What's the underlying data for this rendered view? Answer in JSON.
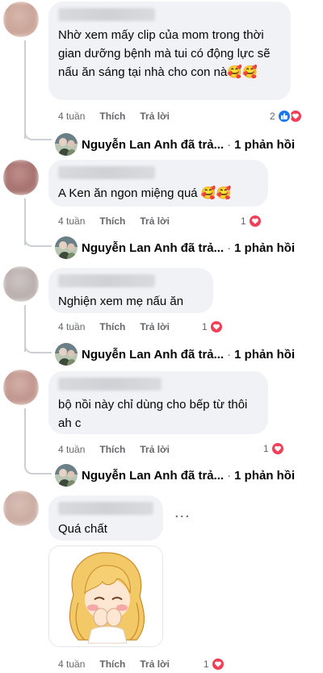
{
  "colors": {
    "bubble_bg": "#f0f2f5",
    "meta_text": "#65676b",
    "like_blue": "#1877f2",
    "heart_red": "#f33e58",
    "thread_line": "#ccd0d5"
  },
  "reply_user": "Nguyễn Lan Anh đã trả...",
  "reply_count": "1 phản hồi",
  "separator": "·",
  "more_label": "...",
  "actions": {
    "like": "Thích",
    "reply": "Trả lời"
  },
  "comments": [
    {
      "text": "Nhờ xem mấy clip của mom trong thời gian dưỡng bệnh mà tui có động lực sẽ nấu ăn sáng tại nhà cho con nà🥰🥰",
      "time": "4 tuần",
      "react_count": "2",
      "icons": [
        "like-icon",
        "heart-icon"
      ]
    },
    {
      "text": "A Ken ăn ngon miệng quá 🥰🥰",
      "time": "4 tuần",
      "react_count": "1",
      "icons": [
        "heart-icon"
      ]
    },
    {
      "text": "Nghiện xem mẹ nấu ăn",
      "time": "4 tuần",
      "react_count": "1",
      "icons": [
        "heart-icon"
      ]
    },
    {
      "text": "bộ nồi này chỉ dùng cho bếp từ thôi ah c",
      "time": "4 tuần",
      "react_count": "1",
      "icons": [
        "heart-icon"
      ]
    },
    {
      "text": "Quá chất",
      "time": "4 tuần",
      "react_count": "1",
      "icons": [
        "heart-icon"
      ],
      "sticker": "cartoon-girl-sticker"
    }
  ]
}
